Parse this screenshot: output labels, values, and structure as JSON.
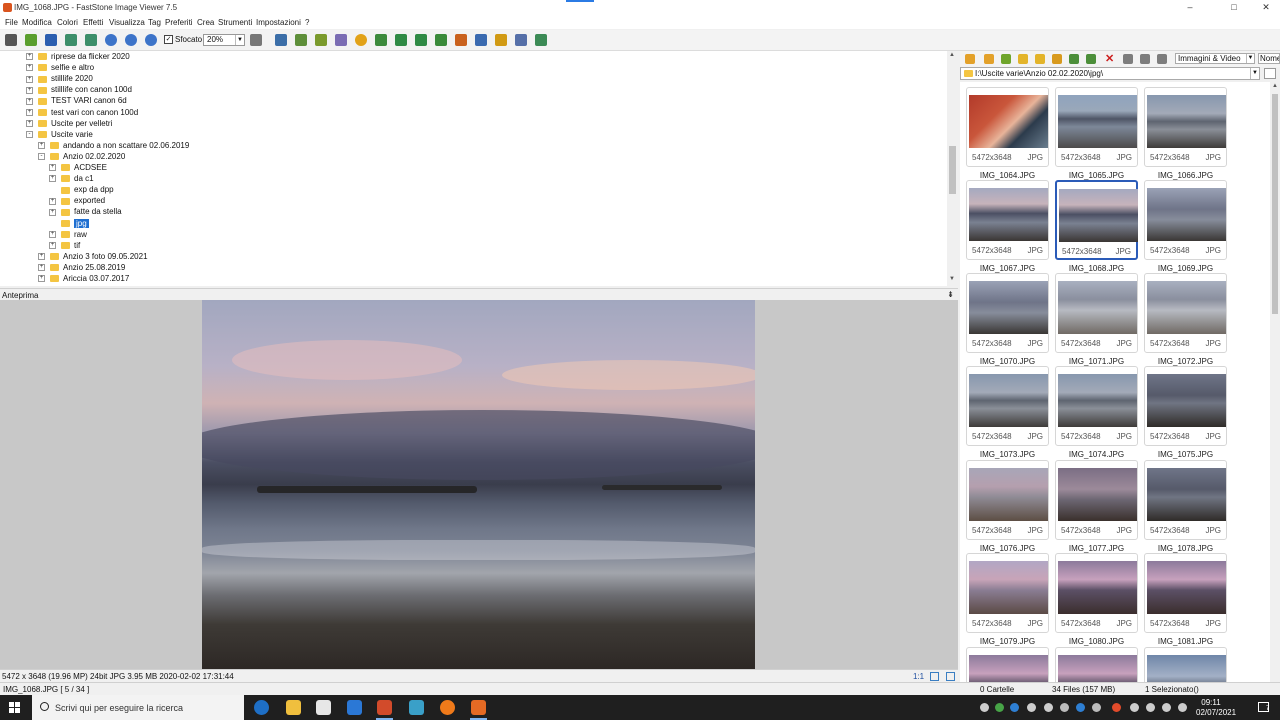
{
  "window": {
    "title": "IMG_1068.JPG - FastStone Image Viewer 7.5"
  },
  "menu": [
    "File",
    "Modifica",
    "Colori",
    "Effetti",
    "Visualizza",
    "Tag",
    "Preferiti",
    "Crea",
    "Strumenti",
    "Impostazioni",
    "?"
  ],
  "toolbar": {
    "sfocato_label": "Sfocato",
    "zoom_value": "20%"
  },
  "tree": {
    "items": [
      {
        "label": "riprese da flicker 2020",
        "level": 2,
        "expander": "+"
      },
      {
        "label": "selfie e altro",
        "level": 2,
        "expander": "+"
      },
      {
        "label": "stilllife 2020",
        "level": 2,
        "expander": "+"
      },
      {
        "label": "stilllife con canon 100d",
        "level": 2,
        "expander": "+"
      },
      {
        "label": "TEST VARI canon 6d",
        "level": 2,
        "expander": "+"
      },
      {
        "label": "test vari con canon 100d",
        "level": 2,
        "expander": "+"
      },
      {
        "label": "Uscite per velletri",
        "level": 2,
        "expander": "+"
      },
      {
        "label": "Uscite varie",
        "level": 2,
        "expander": "-"
      },
      {
        "label": "andando a non scattare 02.06.2019",
        "level": 3,
        "expander": "+"
      },
      {
        "label": "Anzio 02.02.2020",
        "level": 3,
        "expander": "-"
      },
      {
        "label": "ACDSEE",
        "level": 4,
        "expander": "+"
      },
      {
        "label": "da c1",
        "level": 4,
        "expander": "+"
      },
      {
        "label": "exp da dpp",
        "level": 4,
        "expander": ""
      },
      {
        "label": "exported",
        "level": 4,
        "expander": "+"
      },
      {
        "label": "fatte da stella",
        "level": 4,
        "expander": "+"
      },
      {
        "label": "jpg",
        "level": 4,
        "expander": "",
        "selected": true
      },
      {
        "label": "raw",
        "level": 4,
        "expander": "+"
      },
      {
        "label": "tif",
        "level": 4,
        "expander": "+"
      },
      {
        "label": "Anzio 3 foto 09.05.2021",
        "level": 3,
        "expander": "+"
      },
      {
        "label": "Anzio 25.08.2019",
        "level": 3,
        "expander": "+"
      },
      {
        "label": "Ariccia 03.07.2017",
        "level": 3,
        "expander": "+"
      }
    ]
  },
  "preview": {
    "header": "Anteprima",
    "pin": "⇟"
  },
  "image_info": {
    "text": "5472 x 3648 (19.96 MP)  24bit  JPG   3.95 MB   2020-02-02 17:31:44",
    "ratio": "1:1"
  },
  "status": {
    "file": "IMG_1068.JPG [ 5 / 34 ]",
    "folders": "0 Cartelle",
    "files": "34 Files (157 MB)",
    "selected": "1 Selezionato()"
  },
  "browser": {
    "filter": "Immagini & Video",
    "sort": "Nome",
    "path": "I:\\Uscite varie\\Anzio 02.02.2020\\jpg\\"
  },
  "thumbnails": [
    {
      "name": "IMG_1064.JPG",
      "dims": "5472x3648",
      "fmt": "JPG",
      "style": "a"
    },
    {
      "name": "IMG_1065.JPG",
      "dims": "5472x3648",
      "fmt": "JPG",
      "style": "b"
    },
    {
      "name": "IMG_1066.JPG",
      "dims": "5472x3648",
      "fmt": "JPG",
      "style": "c"
    },
    {
      "name": "IMG_1067.JPG",
      "dims": "5472x3648",
      "fmt": "JPG",
      "style": "d"
    },
    {
      "name": "IMG_1068.JPG",
      "dims": "5472x3648",
      "fmt": "JPG",
      "style": "d",
      "selected": true
    },
    {
      "name": "IMG_1069.JPG",
      "dims": "5472x3648",
      "fmt": "JPG",
      "style": "e"
    },
    {
      "name": "IMG_1070.JPG",
      "dims": "5472x3648",
      "fmt": "JPG",
      "style": "e"
    },
    {
      "name": "IMG_1071.JPG",
      "dims": "5472x3648",
      "fmt": "JPG",
      "style": "f"
    },
    {
      "name": "IMG_1072.JPG",
      "dims": "5472x3648",
      "fmt": "JPG",
      "style": "f"
    },
    {
      "name": "IMG_1073.JPG",
      "dims": "5472x3648",
      "fmt": "JPG",
      "style": "c"
    },
    {
      "name": "IMG_1074.JPG",
      "dims": "5472x3648",
      "fmt": "JPG",
      "style": "c"
    },
    {
      "name": "IMG_1075.JPG",
      "dims": "5472x3648",
      "fmt": "JPG",
      "style": "g"
    },
    {
      "name": "IMG_1076.JPG",
      "dims": "5472x3648",
      "fmt": "JPG",
      "style": "h"
    },
    {
      "name": "IMG_1077.JPG",
      "dims": "5472x3648",
      "fmt": "JPG",
      "style": "i"
    },
    {
      "name": "IMG_1078.JPG",
      "dims": "5472x3648",
      "fmt": "JPG",
      "style": "g"
    },
    {
      "name": "IMG_1079.JPG",
      "dims": "5472x3648",
      "fmt": "JPG",
      "style": "j"
    },
    {
      "name": "IMG_1080.JPG",
      "dims": "5472x3648",
      "fmt": "JPG",
      "style": "k"
    },
    {
      "name": "IMG_1081.JPG",
      "dims": "5472x3648",
      "fmt": "JPG",
      "style": "k"
    },
    {
      "name": "",
      "dims": "",
      "fmt": "",
      "style": "k"
    },
    {
      "name": "",
      "dims": "",
      "fmt": "",
      "style": "k"
    },
    {
      "name": "",
      "dims": "",
      "fmt": "",
      "style": "l"
    }
  ],
  "taskbar": {
    "search_placeholder": "Scrivi qui per eseguire la ricerca",
    "time": "09:11",
    "date": "02/07/2021",
    "notifications": "7"
  },
  "colors": {
    "selection": "#1f6fd1",
    "folder": "#f4c542",
    "thumb_selected_border": "#2b5bb8"
  }
}
